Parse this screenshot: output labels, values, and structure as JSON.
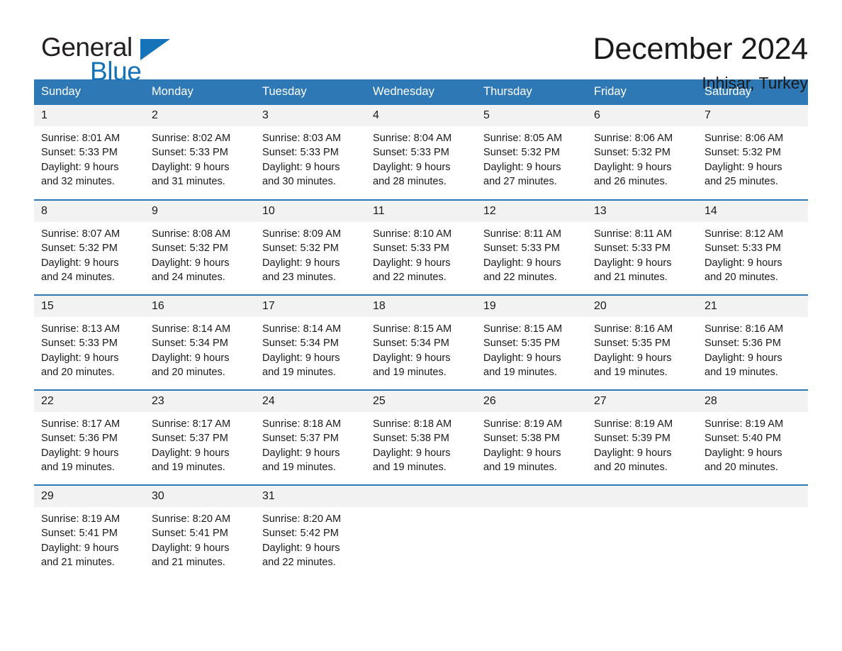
{
  "brand": {
    "word_one": "General",
    "word_two": "Blue",
    "triangle_icon": "triangle-icon",
    "accent_color": "#1571b8"
  },
  "header": {
    "title": "December 2024",
    "subtitle": "Inhisar, Turkey"
  },
  "calendar": {
    "header_color": "#2e78b5",
    "daynum_bg": "#f2f2f2",
    "weekday_headers": [
      "Sunday",
      "Monday",
      "Tuesday",
      "Wednesday",
      "Thursday",
      "Friday",
      "Saturday"
    ],
    "weeks": [
      [
        {
          "day": "1",
          "sunrise": "Sunrise: 8:01 AM",
          "sunset": "Sunset: 5:33 PM",
          "daylight_line1": "Daylight: 9 hours",
          "daylight_line2": "and 32 minutes."
        },
        {
          "day": "2",
          "sunrise": "Sunrise: 8:02 AM",
          "sunset": "Sunset: 5:33 PM",
          "daylight_line1": "Daylight: 9 hours",
          "daylight_line2": "and 31 minutes."
        },
        {
          "day": "3",
          "sunrise": "Sunrise: 8:03 AM",
          "sunset": "Sunset: 5:33 PM",
          "daylight_line1": "Daylight: 9 hours",
          "daylight_line2": "and 30 minutes."
        },
        {
          "day": "4",
          "sunrise": "Sunrise: 8:04 AM",
          "sunset": "Sunset: 5:33 PM",
          "daylight_line1": "Daylight: 9 hours",
          "daylight_line2": "and 28 minutes."
        },
        {
          "day": "5",
          "sunrise": "Sunrise: 8:05 AM",
          "sunset": "Sunset: 5:32 PM",
          "daylight_line1": "Daylight: 9 hours",
          "daylight_line2": "and 27 minutes."
        },
        {
          "day": "6",
          "sunrise": "Sunrise: 8:06 AM",
          "sunset": "Sunset: 5:32 PM",
          "daylight_line1": "Daylight: 9 hours",
          "daylight_line2": "and 26 minutes."
        },
        {
          "day": "7",
          "sunrise": "Sunrise: 8:06 AM",
          "sunset": "Sunset: 5:32 PM",
          "daylight_line1": "Daylight: 9 hours",
          "daylight_line2": "and 25 minutes."
        }
      ],
      [
        {
          "day": "8",
          "sunrise": "Sunrise: 8:07 AM",
          "sunset": "Sunset: 5:32 PM",
          "daylight_line1": "Daylight: 9 hours",
          "daylight_line2": "and 24 minutes."
        },
        {
          "day": "9",
          "sunrise": "Sunrise: 8:08 AM",
          "sunset": "Sunset: 5:32 PM",
          "daylight_line1": "Daylight: 9 hours",
          "daylight_line2": "and 24 minutes."
        },
        {
          "day": "10",
          "sunrise": "Sunrise: 8:09 AM",
          "sunset": "Sunset: 5:32 PM",
          "daylight_line1": "Daylight: 9 hours",
          "daylight_line2": "and 23 minutes."
        },
        {
          "day": "11",
          "sunrise": "Sunrise: 8:10 AM",
          "sunset": "Sunset: 5:33 PM",
          "daylight_line1": "Daylight: 9 hours",
          "daylight_line2": "and 22 minutes."
        },
        {
          "day": "12",
          "sunrise": "Sunrise: 8:11 AM",
          "sunset": "Sunset: 5:33 PM",
          "daylight_line1": "Daylight: 9 hours",
          "daylight_line2": "and 22 minutes."
        },
        {
          "day": "13",
          "sunrise": "Sunrise: 8:11 AM",
          "sunset": "Sunset: 5:33 PM",
          "daylight_line1": "Daylight: 9 hours",
          "daylight_line2": "and 21 minutes."
        },
        {
          "day": "14",
          "sunrise": "Sunrise: 8:12 AM",
          "sunset": "Sunset: 5:33 PM",
          "daylight_line1": "Daylight: 9 hours",
          "daylight_line2": "and 20 minutes."
        }
      ],
      [
        {
          "day": "15",
          "sunrise": "Sunrise: 8:13 AM",
          "sunset": "Sunset: 5:33 PM",
          "daylight_line1": "Daylight: 9 hours",
          "daylight_line2": "and 20 minutes."
        },
        {
          "day": "16",
          "sunrise": "Sunrise: 8:14 AM",
          "sunset": "Sunset: 5:34 PM",
          "daylight_line1": "Daylight: 9 hours",
          "daylight_line2": "and 20 minutes."
        },
        {
          "day": "17",
          "sunrise": "Sunrise: 8:14 AM",
          "sunset": "Sunset: 5:34 PM",
          "daylight_line1": "Daylight: 9 hours",
          "daylight_line2": "and 19 minutes."
        },
        {
          "day": "18",
          "sunrise": "Sunrise: 8:15 AM",
          "sunset": "Sunset: 5:34 PM",
          "daylight_line1": "Daylight: 9 hours",
          "daylight_line2": "and 19 minutes."
        },
        {
          "day": "19",
          "sunrise": "Sunrise: 8:15 AM",
          "sunset": "Sunset: 5:35 PM",
          "daylight_line1": "Daylight: 9 hours",
          "daylight_line2": "and 19 minutes."
        },
        {
          "day": "20",
          "sunrise": "Sunrise: 8:16 AM",
          "sunset": "Sunset: 5:35 PM",
          "daylight_line1": "Daylight: 9 hours",
          "daylight_line2": "and 19 minutes."
        },
        {
          "day": "21",
          "sunrise": "Sunrise: 8:16 AM",
          "sunset": "Sunset: 5:36 PM",
          "daylight_line1": "Daylight: 9 hours",
          "daylight_line2": "and 19 minutes."
        }
      ],
      [
        {
          "day": "22",
          "sunrise": "Sunrise: 8:17 AM",
          "sunset": "Sunset: 5:36 PM",
          "daylight_line1": "Daylight: 9 hours",
          "daylight_line2": "and 19 minutes."
        },
        {
          "day": "23",
          "sunrise": "Sunrise: 8:17 AM",
          "sunset": "Sunset: 5:37 PM",
          "daylight_line1": "Daylight: 9 hours",
          "daylight_line2": "and 19 minutes."
        },
        {
          "day": "24",
          "sunrise": "Sunrise: 8:18 AM",
          "sunset": "Sunset: 5:37 PM",
          "daylight_line1": "Daylight: 9 hours",
          "daylight_line2": "and 19 minutes."
        },
        {
          "day": "25",
          "sunrise": "Sunrise: 8:18 AM",
          "sunset": "Sunset: 5:38 PM",
          "daylight_line1": "Daylight: 9 hours",
          "daylight_line2": "and 19 minutes."
        },
        {
          "day": "26",
          "sunrise": "Sunrise: 8:19 AM",
          "sunset": "Sunset: 5:38 PM",
          "daylight_line1": "Daylight: 9 hours",
          "daylight_line2": "and 19 minutes."
        },
        {
          "day": "27",
          "sunrise": "Sunrise: 8:19 AM",
          "sunset": "Sunset: 5:39 PM",
          "daylight_line1": "Daylight: 9 hours",
          "daylight_line2": "and 20 minutes."
        },
        {
          "day": "28",
          "sunrise": "Sunrise: 8:19 AM",
          "sunset": "Sunset: 5:40 PM",
          "daylight_line1": "Daylight: 9 hours",
          "daylight_line2": "and 20 minutes."
        }
      ],
      [
        {
          "day": "29",
          "sunrise": "Sunrise: 8:19 AM",
          "sunset": "Sunset: 5:41 PM",
          "daylight_line1": "Daylight: 9 hours",
          "daylight_line2": "and 21 minutes."
        },
        {
          "day": "30",
          "sunrise": "Sunrise: 8:20 AM",
          "sunset": "Sunset: 5:41 PM",
          "daylight_line1": "Daylight: 9 hours",
          "daylight_line2": "and 21 minutes."
        },
        {
          "day": "31",
          "sunrise": "Sunrise: 8:20 AM",
          "sunset": "Sunset: 5:42 PM",
          "daylight_line1": "Daylight: 9 hours",
          "daylight_line2": "and 22 minutes."
        },
        {
          "day": "",
          "sunrise": "",
          "sunset": "",
          "daylight_line1": "",
          "daylight_line2": ""
        },
        {
          "day": "",
          "sunrise": "",
          "sunset": "",
          "daylight_line1": "",
          "daylight_line2": ""
        },
        {
          "day": "",
          "sunrise": "",
          "sunset": "",
          "daylight_line1": "",
          "daylight_line2": ""
        },
        {
          "day": "",
          "sunrise": "",
          "sunset": "",
          "daylight_line1": "",
          "daylight_line2": ""
        }
      ]
    ]
  }
}
